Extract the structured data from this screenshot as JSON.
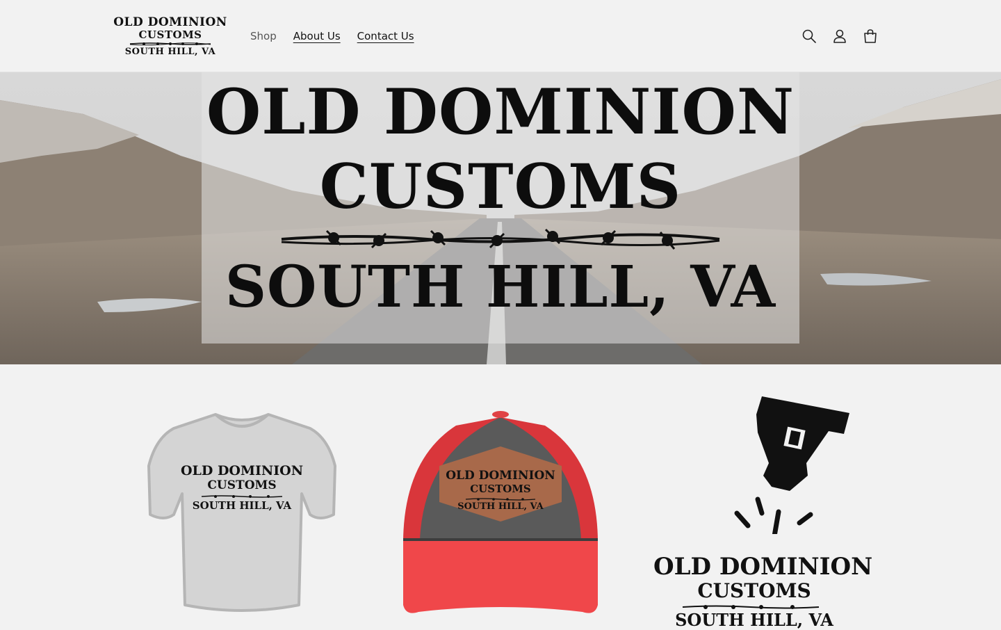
{
  "header": {
    "logo": {
      "line1": "OLD DOMINION",
      "line2": "CUSTOMS",
      "line3": "SOUTH HILL, VA"
    },
    "nav": [
      {
        "label": "Shop"
      },
      {
        "label": "About Us"
      },
      {
        "label": "Contact Us"
      }
    ],
    "icons": [
      "search-icon",
      "account-icon",
      "cart-icon"
    ]
  },
  "hero": {
    "line1": "OLD DOMINION",
    "line2": "CUSTOMS",
    "line3": "SOUTH HILL, VA"
  },
  "products": [
    {
      "kind": "t-shirt",
      "line1": "OLD DOMINION",
      "line2": "CUSTOMS",
      "line3": "SOUTH HILL, VA"
    },
    {
      "kind": "trucker-hat",
      "line1": "OLD DOMINION",
      "line2": "CUSTOMS",
      "line3": "SOUTH HILL, VA"
    },
    {
      "kind": "laser-engraving",
      "line1": "OLD DOMINION",
      "line2": "CUSTOMS",
      "line3": "SOUTH HILL, VA"
    }
  ],
  "colors": {
    "background": "#f2f2f2",
    "text": "#121212",
    "hat_red": "#f0474a",
    "hat_gray": "#5a5a5a",
    "patch_brown": "#a8694a"
  }
}
